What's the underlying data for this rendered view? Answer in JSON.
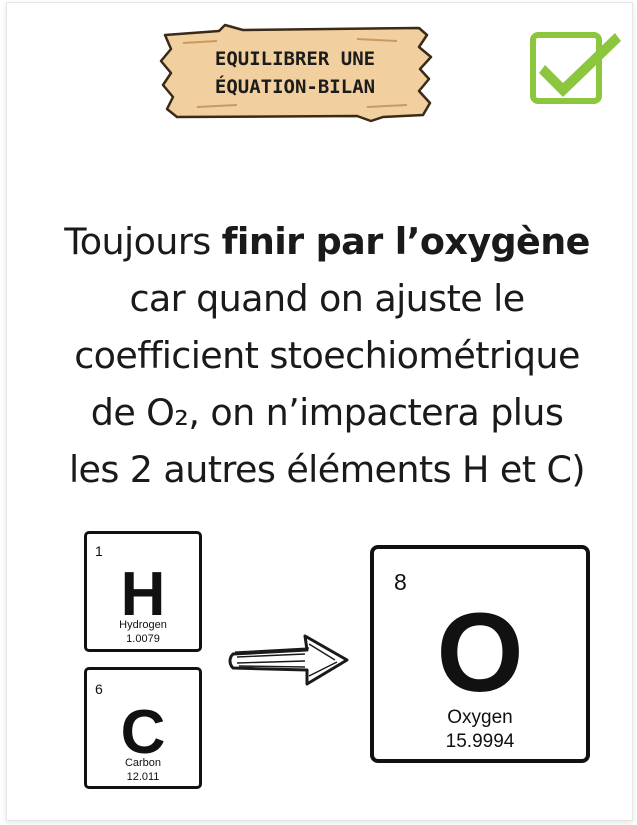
{
  "banner": {
    "line1": "EQUILIBRER UNE",
    "line2": "ÉQUATION-BILAN",
    "color": "#f2cf9e"
  },
  "check_icon": {
    "name": "checkbox-checked-icon",
    "color": "#8cc63f"
  },
  "body": {
    "line1_pre": "Toujours ",
    "line1_bold": "finir par l’oxygène",
    "line2": "car quand on ajuste le",
    "line3": "coefficient stoechiométrique",
    "line4": "de O₂, on n’impactera plus",
    "line5": "les 2 autres éléments H et C)"
  },
  "elements": {
    "hydrogen": {
      "number": "1",
      "symbol": "H",
      "name": "Hydrogen",
      "mass": "1.0079"
    },
    "carbon": {
      "number": "6",
      "symbol": "C",
      "name": "Carbon",
      "mass": "12.011"
    },
    "oxygen": {
      "number": "8",
      "symbol": "O",
      "name": "Oxygen",
      "mass": "15.9994"
    }
  },
  "arrow_icon": {
    "name": "sketch-arrow-right-icon"
  }
}
